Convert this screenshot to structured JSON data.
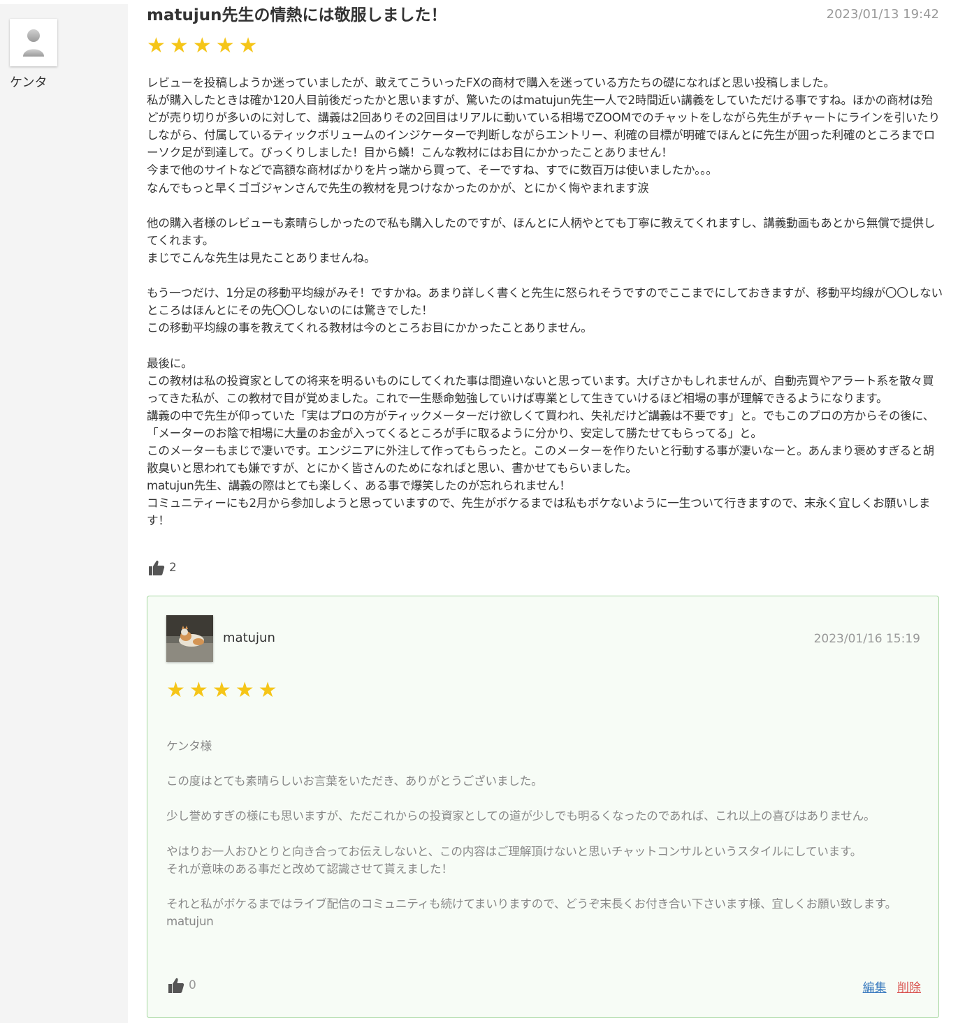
{
  "reviewer": {
    "name": "ケンタ",
    "avatar_icon": "default-user-icon"
  },
  "review": {
    "title": "matujun先生の情熱には敬服しました！",
    "date": "2023/01/13 19:42",
    "rating": 5,
    "body": "レビューを投稿しようか迷っていましたが、敢えてこういったFXの商材で購入を迷っている方たちの礎になればと思い投稿しました。\n私が購入したときは確か120人目前後だったかと思いますが、驚いたのはmatujun先生一人で2時間近い講義をしていただける事ですね。ほかの商材は殆どが売り切りが多いのに対して、講義は2回ありその2回目はリアルに動いている相場でZOOMでのチャットをしながら先生がチャートにラインを引いたりしながら、付属しているティックボリュームのインジケーターで判断しながらエントリー、利確の目標が明確でほんとに先生が囲った利確のところまでローソク足が到達して。びっくりしました！目から鱗！こんな教材にはお目にかかったことありません！\n今まで他のサイトなどで高額な商材ばかりを片っ端から買って、そーですね、すでに数百万は使いましたか。。。\nなんでもっと早くゴゴジャンさんで先生の教材を見つけなかったのかが、とにかく悔やまれます涙\n\n他の購入者様のレビューも素晴らしかったので私も購入したのですが、ほんとに人柄やとても丁寧に教えてくれますし、講義動画もあとから無償で提供してくれます。\nまじでこんな先生は見たことありませんね。\n\nもう一つだけ、1分足の移動平均線がみそ！ですかね。あまり詳しく書くと先生に怒られそうですのでここまでにしておきますが、移動平均線が〇〇しないところはほんとにその先〇〇しないのには驚きでした！\nこの移動平均線の事を教えてくれる教材は今のところお目にかかったことありません。\n\n最後に。\nこの教材は私の投資家としての将来を明るいものにしてくれた事は間違いないと思っています。大げさかもしれませんが、自動売買やアラート系を散々買ってきた私が、この教材で目が覚めました。これで一生懸命勉強していけば専業として生きていけるほど相場の事が理解できるようになります。\n講義の中で先生が仰っていた「実はプロの方がティックメーターだけ欲しくて買われ、失礼だけど講義は不要です」と。でもこのプロの方からその後に、「メーターのお陰で相場に大量のお金が入ってくるところが手に取るように分かり、安定して勝たせてもらってる」と。\nこのメーターもまじで凄いです。エンジニアに外注して作ってもらったと。このメーターを作りたいと行動する事が凄いなーと。あんまり褒めすぎると胡散臭いと思われても嫌ですが、とにかく皆さんのためになればと思い、書かせてもらいました。\nmatujun先生、講義の際はとても楽しく、ある事で爆笑したのが忘れられません！\nコミュニティーにも2月から参加しようと思っていますので、先生がボケるまでは私もボケないように一生ついて行きますので、末永く宜しくお願いします！",
    "likes": "2"
  },
  "reply": {
    "author": "matujun",
    "date": "2023/01/16 15:19",
    "rating": 5,
    "body": "ケンタ様\n\nこの度はとても素晴らしいお言葉をいただき、ありがとうございました。\n\n少し誉めすぎの様にも思いますが、ただこれからの投資家としての道が少しでも明るくなったのであれば、これ以上の喜びはありません。\n\nやはりお一人おひとりと向き合ってお伝えしないと、この内容はご理解頂けないと思いチャットコンサルというスタイルにしています。\nそれが意味のある事だと改めて認識させて貰えました！\n\nそれと私がボケるまではライブ配信のコミュニティも続けてまいりますので、どうぞ末長くお付き合い下さいます様、宜しくお願い致します。\nmatujun",
    "likes": "0",
    "edit_label": "編集",
    "delete_label": "削除"
  },
  "colors": {
    "star": "#f5c518",
    "reply_border": "#a6d7a0",
    "reply_bg": "#f7fcf6"
  }
}
